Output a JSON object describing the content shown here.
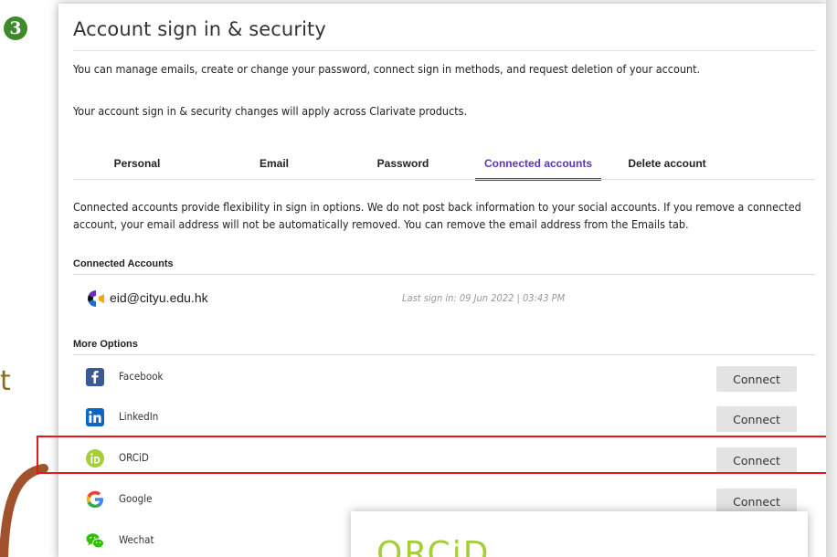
{
  "step_badge": "3",
  "side_letter": "t",
  "title": "Account sign in & security",
  "description_1": "You can manage emails, create or change your password, connect sign in methods, and request deletion of your account.",
  "description_2": "Your account sign in & security changes will apply across Clarivate products.",
  "tabs": [
    {
      "label": "Personal",
      "active": false
    },
    {
      "label": "Email",
      "active": false
    },
    {
      "label": "Password",
      "active": false
    },
    {
      "label": "Connected accounts",
      "active": true
    },
    {
      "label": "Delete account",
      "active": false
    }
  ],
  "info_text": "Connected accounts provide flexibility in sign in options. We do not post back information to your social accounts. If you remove a connected account, your email address will not be automatically removed. You can remove the email address from the Emails tab.",
  "connected_accounts": {
    "heading": "Connected Accounts",
    "email": "eid@cityu.edu.hk",
    "last_sign_in": "Last sign in: 09 Jun 2022 | 03:43 PM"
  },
  "more_options": {
    "heading": "More Options",
    "items": [
      {
        "label": "Facebook",
        "icon": "facebook-icon",
        "button": "Connect"
      },
      {
        "label": "LinkedIn",
        "icon": "linkedin-icon",
        "button": "Connect"
      },
      {
        "label": "ORCiD",
        "icon": "orcid-icon",
        "button": "Connect"
      },
      {
        "label": "Google",
        "icon": "google-icon",
        "button": "Connect"
      },
      {
        "label": "Wechat",
        "icon": "wechat-icon",
        "button": ""
      }
    ]
  },
  "orcid_popup_logo": "ORCiD",
  "colors": {
    "accent": "#5e33bf",
    "highlight": "#e01b1b",
    "button_bg": "#e3e3e3",
    "facebook": "#3b5998",
    "linkedin": "#0a66c2",
    "orcid": "#a6ce39",
    "wechat": "#2dc100"
  }
}
